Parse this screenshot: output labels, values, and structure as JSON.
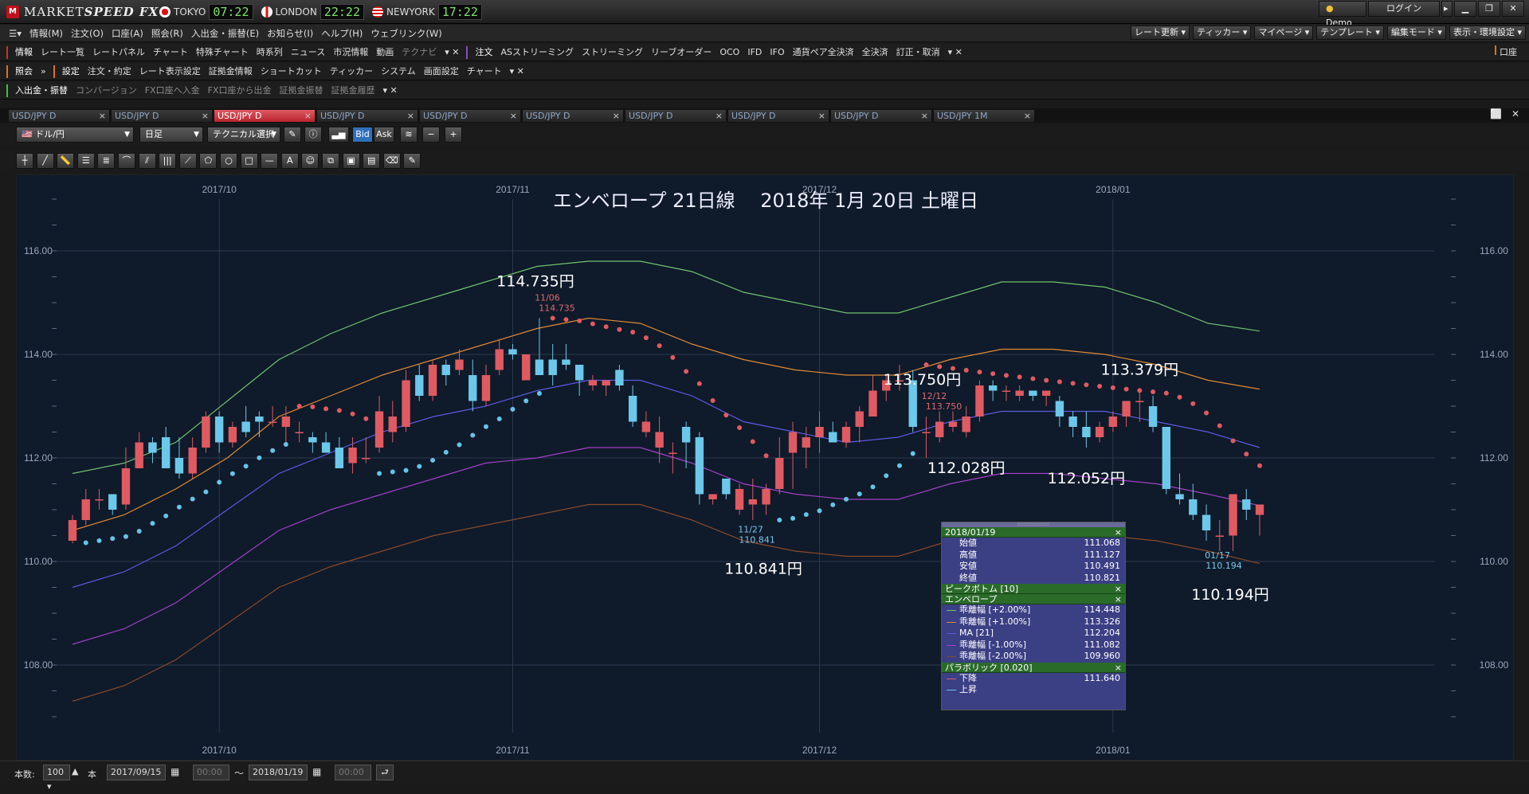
{
  "app": {
    "title": "MARKETSPEED FX",
    "title_a": "MARKET",
    "title_b": "SPEED FX"
  },
  "clocks": [
    {
      "name": "TOKYO",
      "time": "07:22"
    },
    {
      "name": "LONDON",
      "time": "22:22"
    },
    {
      "name": "NEWYORK",
      "time": "17:22"
    }
  ],
  "topright": {
    "demo": "Demo",
    "login": "ログイン"
  },
  "menu": [
    "情報(M)",
    "注文(O)",
    "口座(A)",
    "照会(R)",
    "入出金・振替(E)",
    "お知らせ(I)",
    "ヘルプ(H)",
    "ウェブリンク(W)"
  ],
  "menu_right": [
    "レート更新",
    "ティッカー",
    "マイページ",
    "テンプレート",
    "編集モード",
    "表示・環境設定"
  ],
  "toolbar1": {
    "info_head": "情報",
    "info_items": [
      "レート一覧",
      "レートパネル",
      "チャート",
      "特殊チャート",
      "時系列",
      "ニュース",
      "市況情報",
      "動画"
    ],
    "info_dim": "テクナビ",
    "order_head": "注文",
    "order_items": [
      "ASストリーミング",
      "ストリーミング",
      "リーブオーダー",
      "OCO",
      "IFD",
      "IFO",
      "通貨ペア全決済",
      "全決済",
      "訂正・取消"
    ],
    "account_head": "口座"
  },
  "toolbar2": {
    "query_head": "照会",
    "settings_head": "設定",
    "items": [
      "注文・約定",
      "レート表示設定",
      "証拠金情報",
      "ショートカット",
      "ティッカー",
      "システム",
      "画面設定",
      "チャート"
    ]
  },
  "toolbar3": {
    "head": "入出金・振替",
    "items": [
      "コンバージョン",
      "FX口座へ入金",
      "FX口座から出金",
      "証拠金振替",
      "証拠金履歴"
    ]
  },
  "tabs": [
    "USD/JPY D",
    "USD/JPY D",
    "USD/JPY D",
    "USD/JPY D",
    "USD/JPY D",
    "USD/JPY D",
    "USD/JPY D",
    "USD/JPY D",
    "USD/JPY D",
    "USD/JPY 1M"
  ],
  "active_tab": 2,
  "controls": {
    "pair": "ドル/円",
    "period": "日足",
    "technical": "テクニカル選択",
    "bid": "Bid",
    "ask": "Ask"
  },
  "chart_data": {
    "type": "candlestick",
    "title": "エンベロープ 21日線　 2018年 1月 20日 土曜日",
    "x_ticks": [
      "2017/10",
      "2017/11",
      "2017/12",
      "2018/01"
    ],
    "y_ticks": [
      108.0,
      110.0,
      112.0,
      114.0,
      116.0
    ],
    "ylim": [
      107.0,
      117.0
    ],
    "candles": [
      [
        110.4,
        110.9,
        110.35,
        110.8
      ],
      [
        110.8,
        111.4,
        110.7,
        111.2
      ],
      [
        111.2,
        111.4,
        111.0,
        111.2
      ],
      [
        111.3,
        111.3,
        110.9,
        111.0
      ],
      [
        111.1,
        112.2,
        111.0,
        111.8
      ],
      [
        111.8,
        112.5,
        111.8,
        112.3
      ],
      [
        112.3,
        112.4,
        111.9,
        112.1
      ],
      [
        112.4,
        112.6,
        111.8,
        111.8
      ],
      [
        112.0,
        112.4,
        111.6,
        111.7
      ],
      [
        111.7,
        112.4,
        111.6,
        112.2
      ],
      [
        112.2,
        112.9,
        112.1,
        112.8
      ],
      [
        112.8,
        112.9,
        112.1,
        112.3
      ],
      [
        112.3,
        112.7,
        112.2,
        112.6
      ],
      [
        112.7,
        113.0,
        112.4,
        112.5
      ],
      [
        112.8,
        112.9,
        112.4,
        112.7
      ],
      [
        112.7,
        113.0,
        112.6,
        112.7
      ],
      [
        112.6,
        113.0,
        112.3,
        112.8
      ],
      [
        112.5,
        112.7,
        112.3,
        112.5
      ],
      [
        112.4,
        112.5,
        112.1,
        112.3
      ],
      [
        112.3,
        112.5,
        112.1,
        112.1
      ],
      [
        112.2,
        112.4,
        111.8,
        111.8
      ],
      [
        111.9,
        112.4,
        111.7,
        112.2
      ],
      [
        112.0,
        112.4,
        111.9,
        112.0
      ],
      [
        112.2,
        113.2,
        112.1,
        112.9
      ],
      [
        112.5,
        113.1,
        112.3,
        112.8
      ],
      [
        112.6,
        113.7,
        112.5,
        113.5
      ],
      [
        113.6,
        113.8,
        113.1,
        113.2
      ],
      [
        113.2,
        113.9,
        113.1,
        113.8
      ],
      [
        113.8,
        113.9,
        113.4,
        113.6
      ],
      [
        113.7,
        114.1,
        113.6,
        113.9
      ],
      [
        113.6,
        113.9,
        112.9,
        113.1
      ],
      [
        113.1,
        113.8,
        113.0,
        113.6
      ],
      [
        113.7,
        114.3,
        113.6,
        114.1
      ],
      [
        114.1,
        114.2,
        113.9,
        114.0
      ],
      [
        113.5,
        114.0,
        113.5,
        114.0
      ],
      [
        113.9,
        114.7,
        113.6,
        113.6
      ],
      [
        113.9,
        114.2,
        113.4,
        113.6
      ],
      [
        113.9,
        114.2,
        113.7,
        113.8
      ],
      [
        113.8,
        113.8,
        113.2,
        113.5
      ],
      [
        113.4,
        113.6,
        113.3,
        113.5
      ],
      [
        113.4,
        113.5,
        113.2,
        113.5
      ],
      [
        113.7,
        113.8,
        113.3,
        113.4
      ],
      [
        113.2,
        113.4,
        112.6,
        112.7
      ],
      [
        112.5,
        112.9,
        112.4,
        112.7
      ],
      [
        112.2,
        112.8,
        111.9,
        112.5
      ],
      [
        112.1,
        112.3,
        111.7,
        112.1
      ],
      [
        112.6,
        112.7,
        111.8,
        112.3
      ],
      [
        112.4,
        112.5,
        111.1,
        111.3
      ],
      [
        111.2,
        111.3,
        111.1,
        111.3
      ],
      [
        111.6,
        111.6,
        111.2,
        111.3
      ],
      [
        111.0,
        111.5,
        110.9,
        111.4
      ],
      [
        111.1,
        111.6,
        110.8,
        111.2
      ],
      [
        111.1,
        111.5,
        110.9,
        111.4
      ],
      [
        111.4,
        112.4,
        111.3,
        112.0
      ],
      [
        112.1,
        112.7,
        111.4,
        112.5
      ],
      [
        112.2,
        112.6,
        111.8,
        112.4
      ],
      [
        112.4,
        112.9,
        112.1,
        112.6
      ],
      [
        112.5,
        112.7,
        112.3,
        112.3
      ],
      [
        112.3,
        112.7,
        112.2,
        112.6
      ],
      [
        112.6,
        113.0,
        112.3,
        112.9
      ],
      [
        112.8,
        113.6,
        112.8,
        113.3
      ],
      [
        113.3,
        113.6,
        113.1,
        113.5
      ],
      [
        113.5,
        113.8,
        113.3,
        113.5
      ],
      [
        113.5,
        113.7,
        112.5,
        112.6
      ],
      [
        112.5,
        112.8,
        112.0,
        112.5
      ],
      [
        112.4,
        112.9,
        112.3,
        112.7
      ],
      [
        112.6,
        112.9,
        112.5,
        112.7
      ],
      [
        112.5,
        113.0,
        112.4,
        112.8
      ],
      [
        112.8,
        113.5,
        112.7,
        113.4
      ],
      [
        113.4,
        113.5,
        113.1,
        113.3
      ],
      [
        113.3,
        113.4,
        113.1,
        113.3
      ],
      [
        113.2,
        113.4,
        113.1,
        113.3
      ],
      [
        113.3,
        113.3,
        113.1,
        113.2
      ],
      [
        113.2,
        113.3,
        113.0,
        113.3
      ],
      [
        113.1,
        113.2,
        112.6,
        112.8
      ],
      [
        112.8,
        112.9,
        112.4,
        112.6
      ],
      [
        112.6,
        112.9,
        112.2,
        112.4
      ],
      [
        112.4,
        112.7,
        112.3,
        112.6
      ],
      [
        112.6,
        112.9,
        112.5,
        112.8
      ],
      [
        112.8,
        113.1,
        112.6,
        113.1
      ],
      [
        113.1,
        113.3,
        112.7,
        113.1
      ],
      [
        113.0,
        113.2,
        112.5,
        112.6
      ],
      [
        112.6,
        112.6,
        111.3,
        111.4
      ],
      [
        111.3,
        111.7,
        111.1,
        111.2
      ],
      [
        111.2,
        111.5,
        110.8,
        110.9
      ],
      [
        110.9,
        111.1,
        110.4,
        110.6
      ],
      [
        110.5,
        110.8,
        110.2,
        110.5
      ],
      [
        110.5,
        111.3,
        110.2,
        111.3
      ],
      [
        111.2,
        111.4,
        110.8,
        111.0
      ],
      [
        110.9,
        111.1,
        110.5,
        111.1
      ]
    ],
    "lines": {
      "upper2": {
        "name": "乖離幅 [+2.00%]",
        "color": "#6fc26f",
        "points": [
          111.7,
          111.9,
          112.3,
          113.1,
          113.9,
          114.4,
          114.8,
          115.1,
          115.4,
          115.7,
          115.8,
          115.8,
          115.6,
          115.2,
          115.0,
          114.8,
          114.8,
          115.1,
          115.4,
          115.4,
          115.3,
          115.0,
          114.6,
          114.45
        ]
      },
      "upper1": {
        "name": "乖離幅 [+1.00%]",
        "color": "#e08a35",
        "points": [
          110.6,
          110.9,
          111.4,
          112.0,
          112.8,
          113.2,
          113.6,
          113.9,
          114.2,
          114.5,
          114.7,
          114.6,
          114.2,
          113.9,
          113.7,
          113.6,
          113.6,
          113.9,
          114.1,
          114.1,
          114.0,
          113.8,
          113.5,
          113.33
        ]
      },
      "ma": {
        "name": "MA [21]",
        "color": "#5a5ae0",
        "points": [
          109.5,
          109.8,
          110.3,
          111.0,
          111.7,
          112.1,
          112.5,
          112.8,
          113.0,
          113.3,
          113.5,
          113.5,
          113.2,
          112.7,
          112.5,
          112.3,
          112.4,
          112.7,
          112.9,
          112.9,
          112.9,
          112.7,
          112.5,
          112.2
        ]
      },
      "lower1": {
        "name": "乖離幅 [-1.00%]",
        "color": "#a040c8",
        "points": [
          108.4,
          108.7,
          109.2,
          109.9,
          110.6,
          111.0,
          111.3,
          111.6,
          111.9,
          112.0,
          112.2,
          112.2,
          111.9,
          111.5,
          111.3,
          111.2,
          111.2,
          111.5,
          111.7,
          111.7,
          111.6,
          111.5,
          111.3,
          111.08
        ]
      },
      "lower2": {
        "name": "乖離幅 [-2.00%]",
        "color": "#8a4a2a",
        "points": [
          107.3,
          107.6,
          108.1,
          108.8,
          109.5,
          109.9,
          110.2,
          110.5,
          110.7,
          110.9,
          111.1,
          111.1,
          110.8,
          110.4,
          110.2,
          110.1,
          110.1,
          110.4,
          110.6,
          110.6,
          110.5,
          110.4,
          110.2,
          109.96
        ]
      }
    },
    "sar": {
      "name": "パラボリック [0.020]",
      "down_label": "下降",
      "up_label": "上昇",
      "down_color": "#e05a62",
      "up_color": "#66c4e8"
    },
    "annotations": [
      {
        "big": "114.735円",
        "date": "11/06",
        "val": "114.735",
        "kind": "high"
      },
      {
        "big": "110.841円",
        "date": "11/27",
        "val": "110.841",
        "kind": "low"
      },
      {
        "big": "113.750円",
        "date": "12/12",
        "val": "113.750",
        "kind": "high"
      },
      {
        "big": "112.028円",
        "kind": "low2"
      },
      {
        "big": "112.052円",
        "kind": "low2"
      },
      {
        "big": "113.379円",
        "kind": "high2"
      },
      {
        "big": "110.194円",
        "date": "01/17",
        "val": "110.194",
        "kind": "low"
      }
    ]
  },
  "popup": {
    "date": "2018/01/19",
    "ohlc": [
      {
        "label": "始値",
        "value": "111.068"
      },
      {
        "label": "高値",
        "value": "111.127"
      },
      {
        "label": "安値",
        "value": "110.491"
      },
      {
        "label": "終値",
        "value": "110.821"
      }
    ],
    "peak": "ピークボトム [10]",
    "envelope": "エンベロープ",
    "env_rows": [
      {
        "label": "乖離幅 [+2.00%]",
        "value": "114.448",
        "color": "#6fc26f"
      },
      {
        "label": "乖離幅 [+1.00%]",
        "value": "113.326",
        "color": "#e08a35"
      },
      {
        "label": "MA [21]",
        "value": "112.204",
        "color": "#5a5ae0"
      },
      {
        "label": "乖離幅 [-1.00%]",
        "value": "111.082",
        "color": "#a040c8"
      },
      {
        "label": "乖離幅 [-2.00%]",
        "value": "109.960",
        "color": "#8a4a2a"
      }
    ],
    "parabolic": "パラボリック [0.020]",
    "sar_rows": [
      {
        "label": "下降",
        "value": "111.640",
        "color": "#e05a62"
      },
      {
        "label": "上昇",
        "value": "",
        "color": "#66c4e8"
      }
    ]
  },
  "status": {
    "count_label": "本数:",
    "count": "100",
    "unit": "本",
    "from_date": "2017/09/15",
    "from_time": "00:00",
    "tilde": "～",
    "to_date": "2018/01/19",
    "to_time": "00:00"
  },
  "colors": {
    "bull": "#e05a62",
    "bear": "#6cc8ea",
    "bg": "#0f1a2a"
  }
}
